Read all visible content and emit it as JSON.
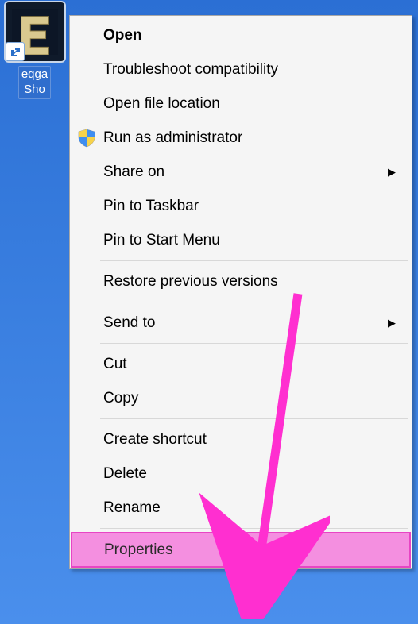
{
  "desktop": {
    "icon_label_line1": "eqga",
    "icon_label_line2": "Sho"
  },
  "menu": {
    "items": [
      {
        "key": "open",
        "label": "Open",
        "bold": true,
        "icon": null,
        "submenu": false
      },
      {
        "key": "troubleshoot",
        "label": "Troubleshoot compatibility",
        "bold": false,
        "icon": null,
        "submenu": false
      },
      {
        "key": "open-file-location",
        "label": "Open file location",
        "bold": false,
        "icon": null,
        "submenu": false
      },
      {
        "key": "run-as-admin",
        "label": "Run as administrator",
        "bold": false,
        "icon": "shield",
        "submenu": false
      },
      {
        "key": "share-on",
        "label": "Share on",
        "bold": false,
        "icon": null,
        "submenu": true
      },
      {
        "key": "pin-taskbar",
        "label": "Pin to Taskbar",
        "bold": false,
        "icon": null,
        "submenu": false
      },
      {
        "key": "pin-start",
        "label": "Pin to Start Menu",
        "bold": false,
        "icon": null,
        "submenu": false
      },
      {
        "sep": true
      },
      {
        "key": "restore-versions",
        "label": "Restore previous versions",
        "bold": false,
        "icon": null,
        "submenu": false
      },
      {
        "sep": true
      },
      {
        "key": "send-to",
        "label": "Send to",
        "bold": false,
        "icon": null,
        "submenu": true
      },
      {
        "sep": true
      },
      {
        "key": "cut",
        "label": "Cut",
        "bold": false,
        "icon": null,
        "submenu": false
      },
      {
        "key": "copy",
        "label": "Copy",
        "bold": false,
        "icon": null,
        "submenu": false
      },
      {
        "sep": true
      },
      {
        "key": "create-shortcut",
        "label": "Create shortcut",
        "bold": false,
        "icon": null,
        "submenu": false
      },
      {
        "key": "delete",
        "label": "Delete",
        "bold": false,
        "icon": null,
        "submenu": false
      },
      {
        "key": "rename",
        "label": "Rename",
        "bold": false,
        "icon": null,
        "submenu": false
      },
      {
        "sep": true
      },
      {
        "key": "properties",
        "label": "Properties",
        "bold": false,
        "icon": null,
        "submenu": false,
        "highlight": true
      }
    ]
  },
  "annotation": {
    "target": "properties",
    "color": "#ff2fd0"
  }
}
